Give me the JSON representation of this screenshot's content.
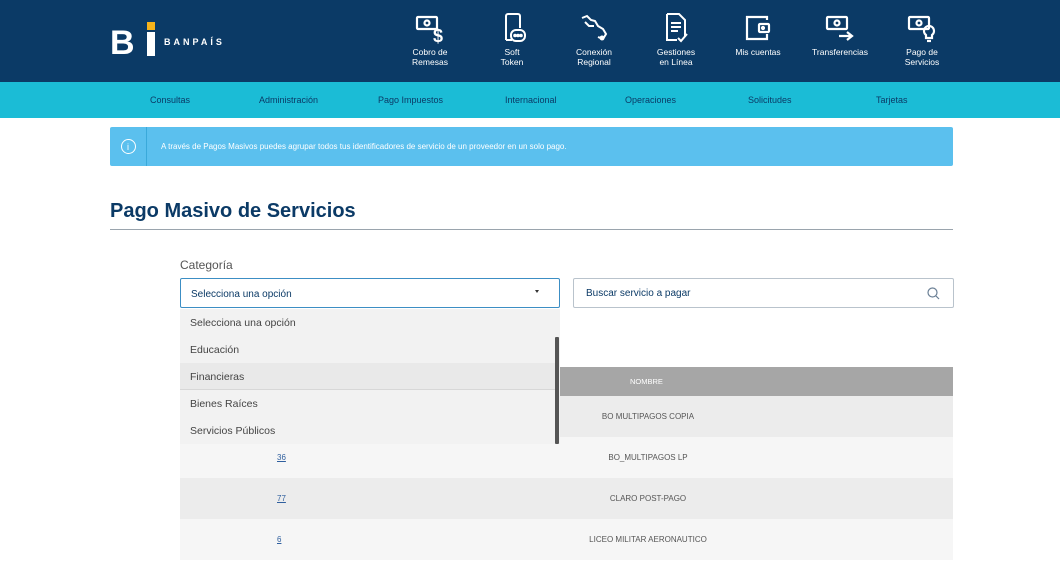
{
  "brand": {
    "logo_text": "BANPAÍS",
    "primary": "#0b3a66",
    "accent": "#1bbcd6",
    "banner": "#5bc0ee"
  },
  "top_nav": [
    {
      "label": "Cobro de\nRemesas",
      "icon": "money-dollar-icon"
    },
    {
      "label": "Soft\nToken",
      "icon": "phone-token-icon"
    },
    {
      "label": "Conexión\nRegional",
      "icon": "map-region-icon"
    },
    {
      "label": "Gestiones\nen Línea",
      "icon": "document-check-icon"
    },
    {
      "label": "Mis cuentas",
      "icon": "wallet-icon"
    },
    {
      "label": "Transferencias",
      "icon": "money-transfer-icon"
    },
    {
      "label": "Pago de\nServicios",
      "icon": "money-bulb-icon"
    }
  ],
  "menu": [
    "Consultas",
    "Administración",
    "Pago Impuestos",
    "Internacional",
    "Operaciones",
    "Solicitudes",
    "Tarjetas"
  ],
  "banner": {
    "text": "A través de Pagos Masivos puedes agrupar todos tus identificadores de servicio de un proveedor en un solo pago."
  },
  "page": {
    "title": "Pago Masivo de Servicios"
  },
  "category": {
    "label": "Categoría",
    "selected": "Selecciona una opción",
    "options": [
      "Selecciona una opción",
      "Educación",
      "Financieras",
      "Bienes Raíces",
      "Servicios Públicos"
    ]
  },
  "search": {
    "placeholder": "Buscar servicio a pagar"
  },
  "table": {
    "header": "NOMBRE",
    "rows": [
      {
        "code": "",
        "name": "BO MULTIPAGOS COPIA"
      },
      {
        "code": "36",
        "name": "BO_MULTIPAGOS LP"
      },
      {
        "code": "77",
        "name": "CLARO POST-PAGO"
      },
      {
        "code": "6",
        "name": "LICEO MILITAR AERONAUTICO"
      }
    ]
  }
}
